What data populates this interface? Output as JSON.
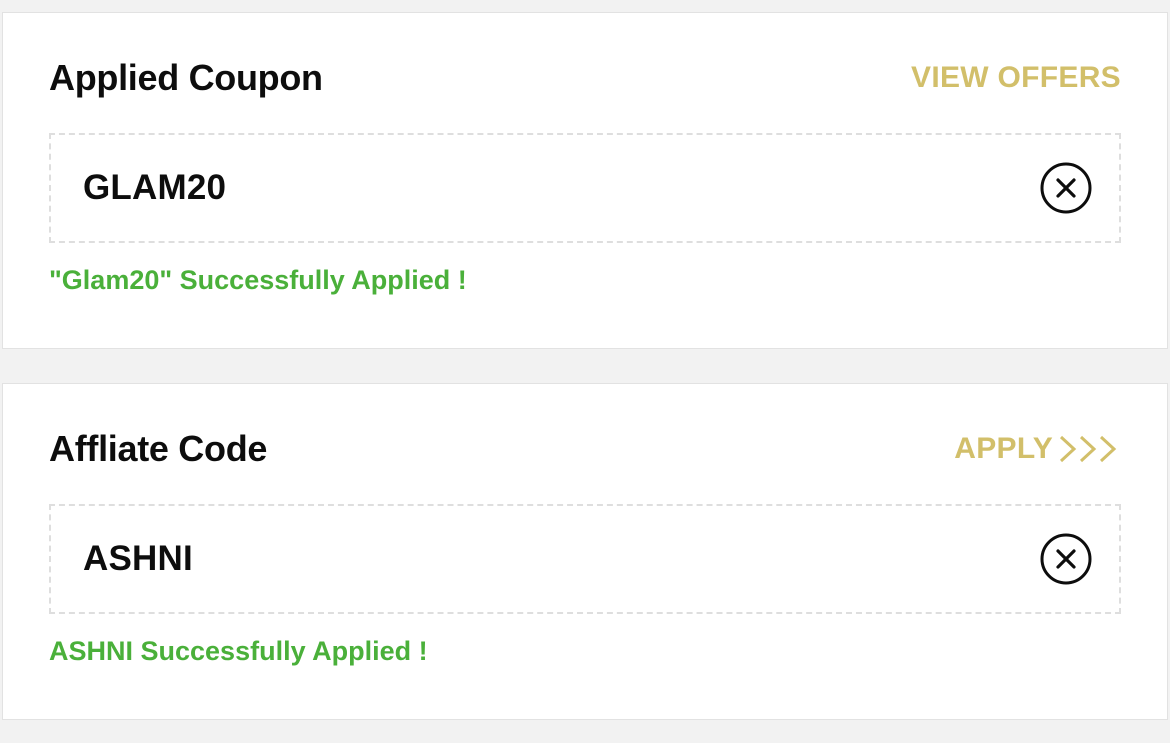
{
  "applied_coupon": {
    "title": "Applied Coupon",
    "action_label": "VIEW OFFERS",
    "code": "GLAM20",
    "remove_icon": "close-circle-icon",
    "status_message": "\"Glam20\" Successfully Applied !"
  },
  "affiliate_code": {
    "title": "Affliate Code",
    "action_label": "APPLY",
    "action_icon": "triple-chevron-right-icon",
    "code": "ASHNI",
    "remove_icon": "close-circle-icon",
    "status_message": "ASHNI Successfully Applied !"
  },
  "colors": {
    "accent_gold": "#d2bf6a",
    "success_green": "#4ab03a",
    "text_dark": "#0d0d0d",
    "dashed_border": "#dedede"
  }
}
